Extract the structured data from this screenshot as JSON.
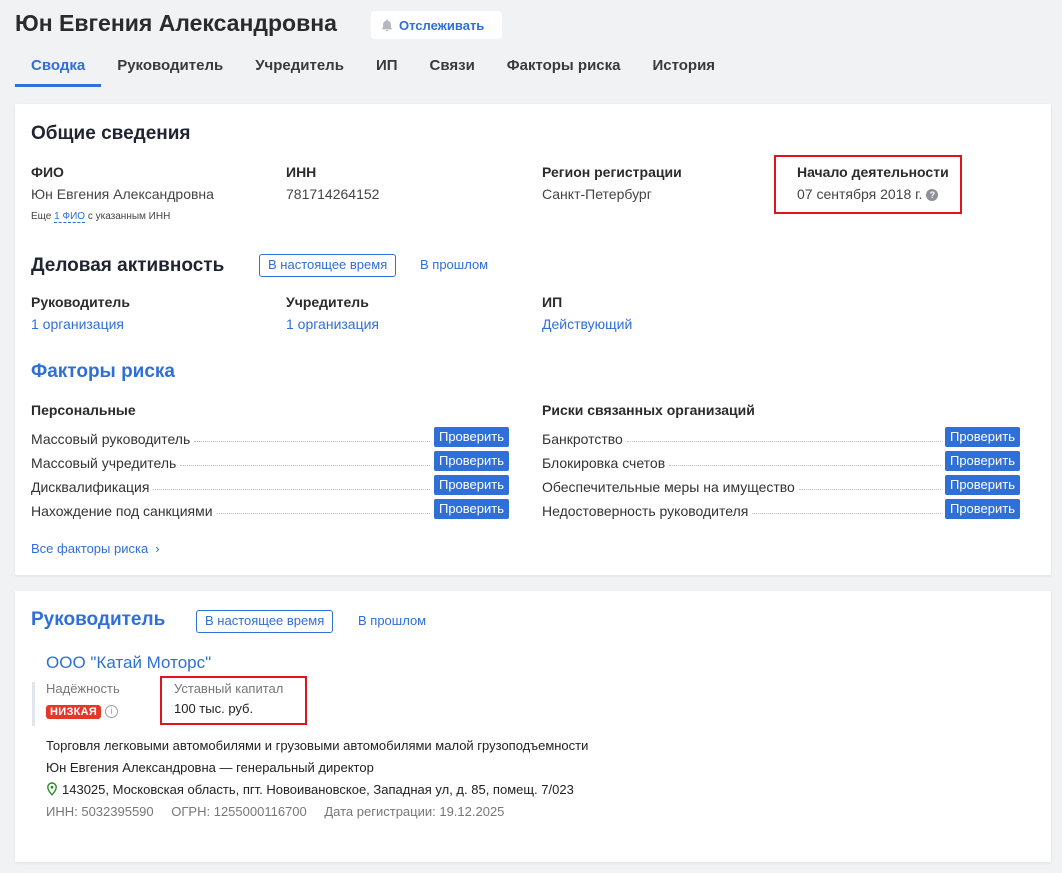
{
  "header": {
    "title": "Юн Евгения Александровна",
    "track_label": "Отслеживать",
    "tabs": [
      "Сводка",
      "Руководитель",
      "Учредитель",
      "ИП",
      "Связи",
      "Факторы риска",
      "История"
    ]
  },
  "general": {
    "heading": "Общие сведения",
    "fio_label": "ФИО",
    "fio_value": "Юн Евгения Александровна",
    "fio_note_prefix": "Еще ",
    "fio_note_link": "1 ФИО",
    "fio_note_suffix": " с указанным ИНН",
    "inn_label": "ИНН",
    "inn_value": "781714264152",
    "region_label": "Регион регистрации",
    "region_value": "Санкт-Петербург",
    "start_label": "Начало деятельности",
    "start_value": "07 сентября 2018 г."
  },
  "business": {
    "heading": "Деловая активность",
    "now_label": "В настоящее время",
    "past_label": "В прошлом",
    "director_label": "Руководитель",
    "director_value": "1 организация",
    "founder_label": "Учредитель",
    "founder_value": "1 организация",
    "ip_label": "ИП",
    "ip_value": "Действующий"
  },
  "risks": {
    "heading": "Факторы риска",
    "personal_label": "Персональные",
    "related_label": "Риски связанных организаций",
    "check_label": "Проверить",
    "personal": [
      "Массовый руководитель",
      "Массовый учредитель",
      "Дисквалификация",
      "Нахождение под санкциями"
    ],
    "related": [
      "Банкротство",
      "Блокировка счетов",
      "Обеспечительные меры на имущество",
      "Недостоверность руководителя"
    ],
    "all_link": "Все факторы риска"
  },
  "director": {
    "heading": "Руководитель",
    "now_label": "В настоящее время",
    "past_label": "В прошлом",
    "org_name": "ООО \"Катай Моторс\"",
    "reliability_label": "Надёжность",
    "reliability_value": "НИЗКАЯ",
    "capital_label": "Уставный капитал",
    "capital_value": "100 тыс. руб.",
    "activity": "Торговля легковыми автомобилями и грузовыми автомобилями малой грузоподъемности",
    "role": "Юн Евгения Александровна — генеральный директор",
    "address": "143025, Московская область, пгт. Новоивановское, Западная ул, д. 85, помещ. 7/023",
    "inn": "ИНН: 5032395590",
    "ogrn": "ОГРН: 1255000116700",
    "reg_date": "Дата регистрации: 19.12.2025"
  },
  "colors": {
    "accent": "#2f6fd8",
    "highlight": "#e0141e",
    "danger": "#e6362a",
    "address": "#2a8a2a"
  }
}
